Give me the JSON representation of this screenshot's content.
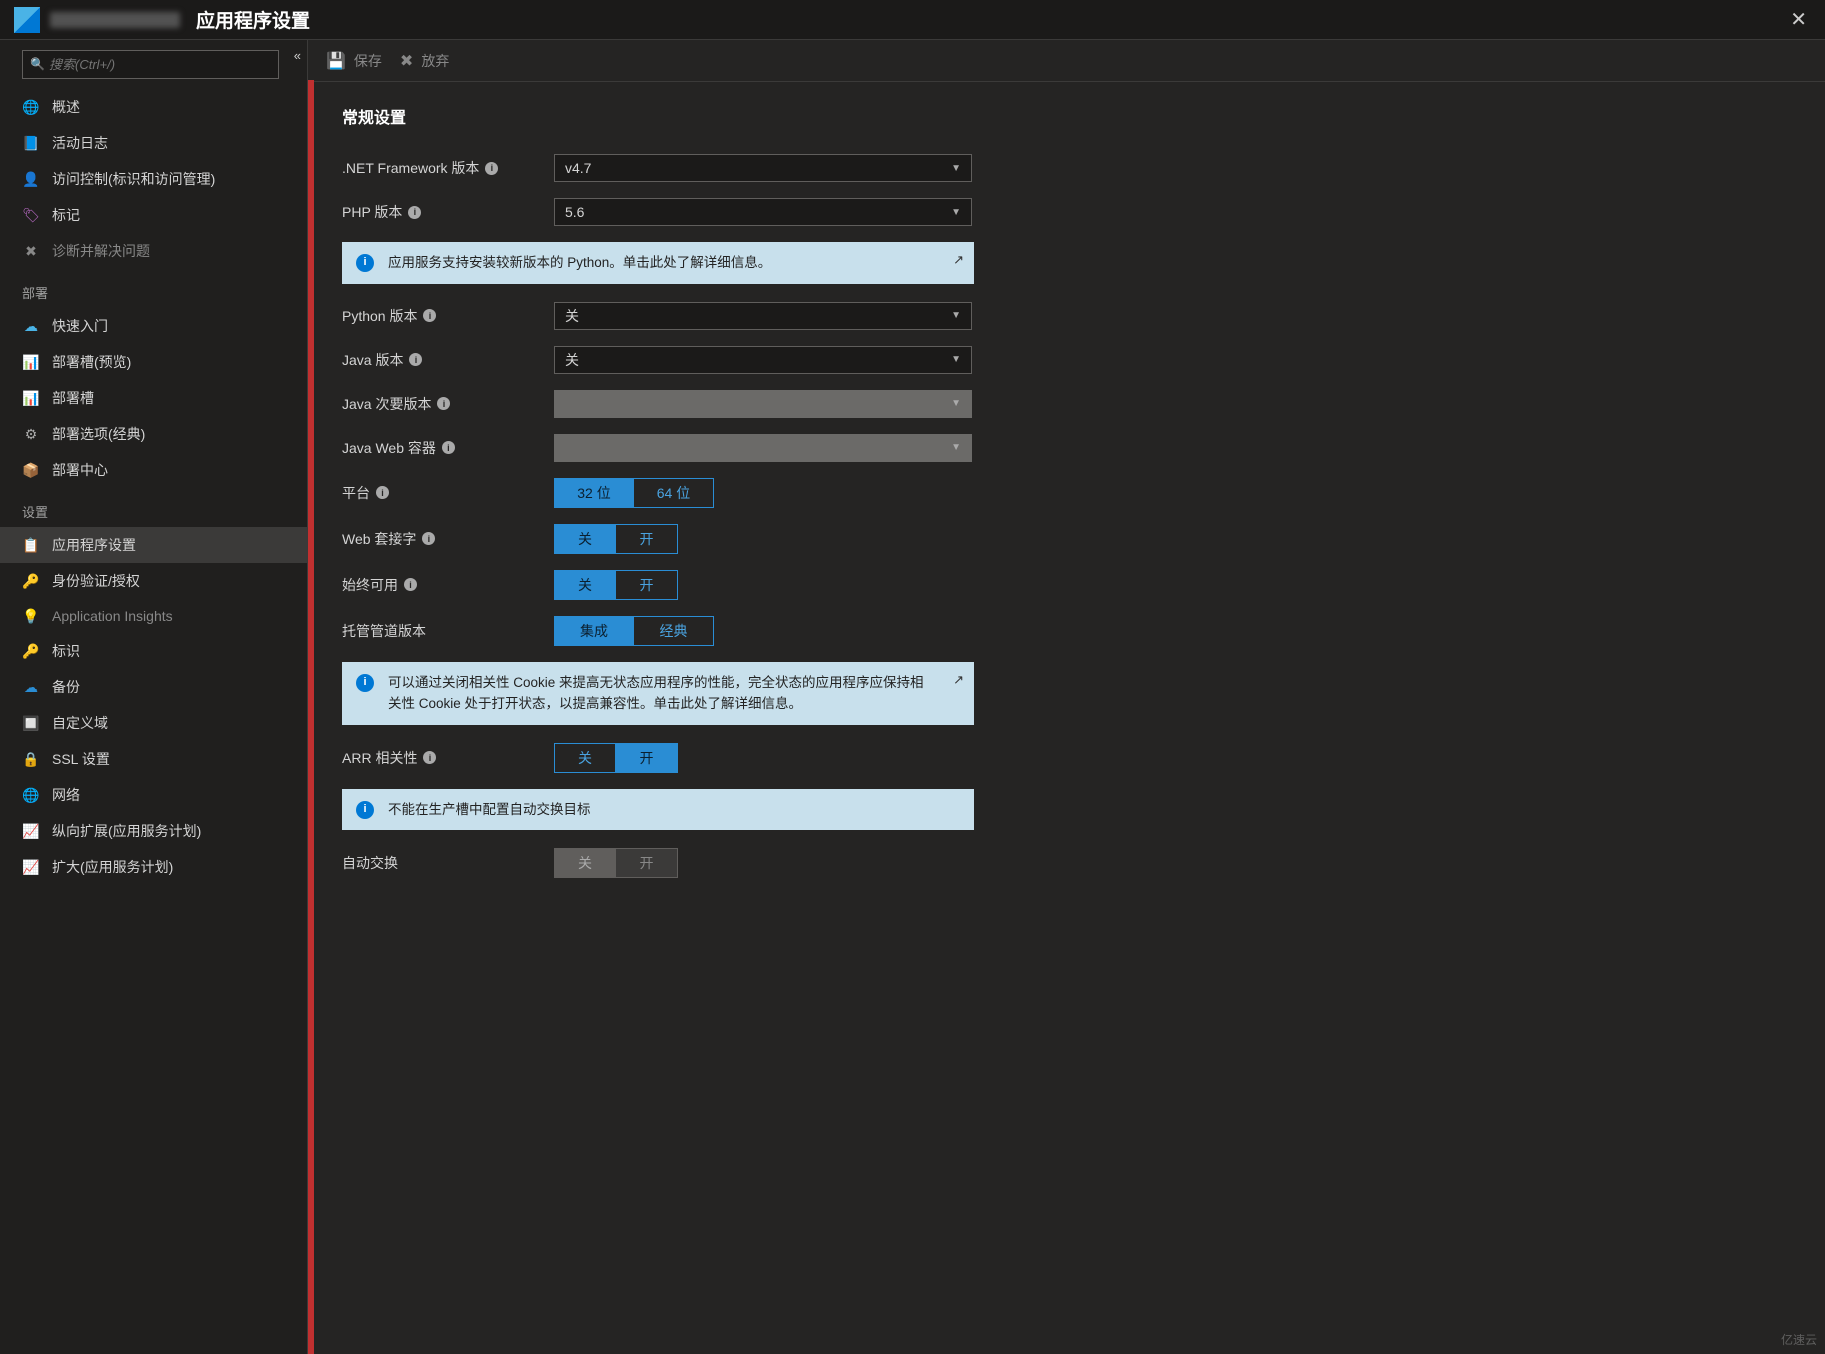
{
  "titlebar": {
    "title": "应用程序设置"
  },
  "search": {
    "placeholder": "搜索(Ctrl+/)"
  },
  "nav": {
    "items": [
      {
        "label": "概述",
        "icon": "globe",
        "cls": "c-globe"
      },
      {
        "label": "活动日志",
        "icon": "log",
        "cls": "c-log"
      },
      {
        "label": "访问控制(标识和访问管理)",
        "icon": "access",
        "cls": "c-acc"
      },
      {
        "label": "标记",
        "icon": "tag",
        "cls": "c-tag"
      },
      {
        "label": "诊断并解决问题",
        "icon": "diag",
        "cls": "c-diag",
        "disabled": true
      }
    ],
    "deploy_label": "部署",
    "deploy": [
      {
        "label": "快速入门",
        "icon": "cloud",
        "cls": "c-cloud"
      },
      {
        "label": "部署槽(预览)",
        "icon": "slot",
        "cls": "c-slot"
      },
      {
        "label": "部署槽",
        "icon": "slot",
        "cls": "c-slot"
      },
      {
        "label": "部署选项(经典)",
        "icon": "cog",
        "cls": "c-cog"
      },
      {
        "label": "部署中心",
        "icon": "center",
        "cls": "c-ctr"
      }
    ],
    "settings_label": "设置",
    "settings": [
      {
        "label": "应用程序设置",
        "icon": "list",
        "cls": "c-list",
        "active": true
      },
      {
        "label": "身份验证/授权",
        "icon": "key",
        "cls": "c-key"
      },
      {
        "label": "Application Insights",
        "icon": "bulb",
        "cls": "c-bulb",
        "disabled": true
      },
      {
        "label": "标识",
        "icon": "id",
        "cls": "c-id"
      },
      {
        "label": "备份",
        "icon": "backup",
        "cls": "c-bak"
      },
      {
        "label": "自定义域",
        "icon": "domain",
        "cls": "c-dom"
      },
      {
        "label": "SSL 设置",
        "icon": "ssl",
        "cls": "c-ssl"
      },
      {
        "label": "网络",
        "icon": "net",
        "cls": "c-net"
      },
      {
        "label": "纵向扩展(应用服务计划)",
        "icon": "scaleup",
        "cls": "c-scale"
      },
      {
        "label": "扩大(应用服务计划)",
        "icon": "scaleout",
        "cls": "c-scale"
      }
    ]
  },
  "toolbar": {
    "save": "保存",
    "discard": "放弃"
  },
  "content": {
    "heading": "常规设置",
    "fields": {
      "dotnet": {
        "label": ".NET Framework 版本",
        "value": "v4.7"
      },
      "php": {
        "label": "PHP 版本",
        "value": "5.6"
      },
      "python": {
        "label": "Python 版本",
        "value": "关"
      },
      "java": {
        "label": "Java 版本",
        "value": "关"
      },
      "java_minor": {
        "label": "Java 次要版本",
        "value": ""
      },
      "java_web": {
        "label": "Java Web 容器",
        "value": ""
      },
      "platform": {
        "label": "平台",
        "opts": [
          "32 位",
          "64 位"
        ],
        "active": 0
      },
      "websockets": {
        "label": "Web 套接字",
        "opts": [
          "关",
          "开"
        ],
        "active": 0
      },
      "alwayson": {
        "label": "始终可用",
        "opts": [
          "关",
          "开"
        ],
        "active": 0
      },
      "pipeline": {
        "label": "托管管道版本",
        "opts": [
          "集成",
          "经典"
        ],
        "active": 0
      },
      "arr": {
        "label": "ARR 相关性",
        "opts": [
          "关",
          "开"
        ],
        "active": 1
      },
      "autoswap": {
        "label": "自动交换",
        "opts": [
          "关",
          "开"
        ],
        "active": 0
      }
    },
    "alerts": {
      "python": "应用服务支持安装较新版本的 Python。单击此处了解详细信息。",
      "arr": "可以通过关闭相关性 Cookie 来提高无状态应用程序的性能，完全状态的应用程序应保持相关性 Cookie 处于打开状态，以提高兼容性。单击此处了解详细信息。",
      "autoswap": "不能在生产槽中配置自动交换目标"
    }
  },
  "watermark": "亿速云"
}
